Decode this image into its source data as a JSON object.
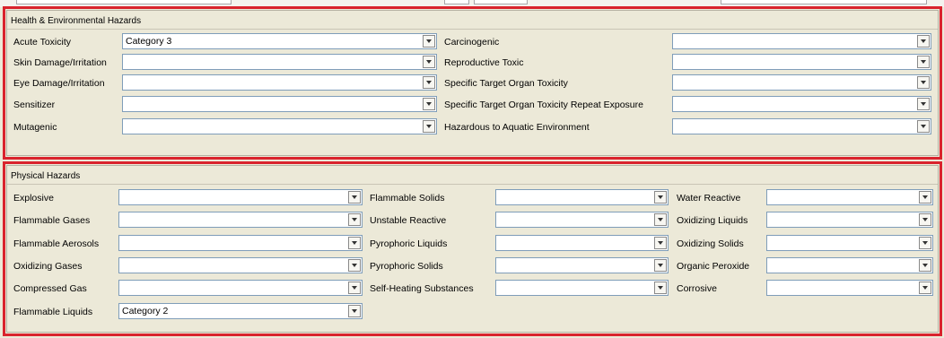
{
  "health": {
    "title": "Health & Environmental Hazards",
    "fields": [
      {
        "label": "Acute Toxicity",
        "value": "Category 3"
      },
      {
        "label": "Skin Damage/Irritation",
        "value": ""
      },
      {
        "label": "Eye Damage/Irritation",
        "value": ""
      },
      {
        "label": "Sensitizer",
        "value": ""
      },
      {
        "label": "Mutagenic",
        "value": ""
      },
      {
        "label": "Carcinogenic",
        "value": ""
      },
      {
        "label": "Reproductive Toxic",
        "value": ""
      },
      {
        "label": "Specific Target Organ Toxicity",
        "value": ""
      },
      {
        "label": "Specific Target Organ Toxicity Repeat Exposure",
        "value": ""
      },
      {
        "label": "Hazardous to Aquatic Environment",
        "value": ""
      }
    ]
  },
  "physical": {
    "title": "Physical Hazards",
    "fields": [
      {
        "label": "Explosive",
        "value": ""
      },
      {
        "label": "Flammable Gases",
        "value": ""
      },
      {
        "label": "Flammable Aerosols",
        "value": ""
      },
      {
        "label": "Oxidizing Gases",
        "value": ""
      },
      {
        "label": "Compressed Gas",
        "value": ""
      },
      {
        "label": "Flammable Liquids",
        "value": "Category 2"
      },
      {
        "label": "Flammable Solids",
        "value": ""
      },
      {
        "label": "Unstable Reactive",
        "value": ""
      },
      {
        "label": "Pyrophoric Liquids",
        "value": ""
      },
      {
        "label": "Pyrophoric Solids",
        "value": ""
      },
      {
        "label": "Self-Heating Substances",
        "value": ""
      },
      {
        "label": "Water Reactive",
        "value": ""
      },
      {
        "label": "Oxidizing Liquids",
        "value": ""
      },
      {
        "label": "Oxidizing Solids",
        "value": ""
      },
      {
        "label": "Organic Peroxide",
        "value": ""
      },
      {
        "label": "Corrosive",
        "value": ""
      }
    ]
  },
  "colors": {
    "highlight_border": "#d9232d",
    "background": "#ece9d8"
  }
}
